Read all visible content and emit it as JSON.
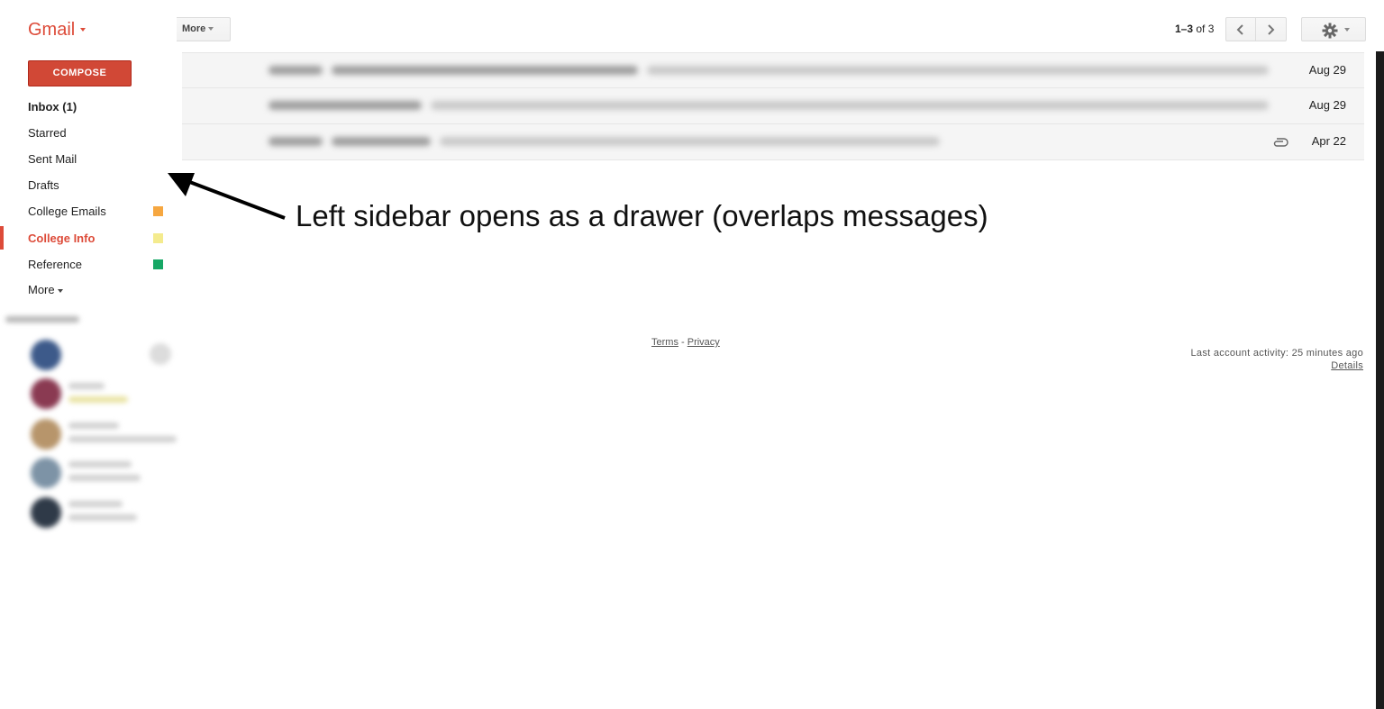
{
  "header": {
    "app_name": "Gmail",
    "more_label": "More",
    "pager_range": "1–3",
    "pager_of": "of 3"
  },
  "sidebar": {
    "compose_label": "COMPOSE",
    "items": [
      {
        "label": "Inbox (1)",
        "bold": true
      },
      {
        "label": "Starred"
      },
      {
        "label": "Sent Mail"
      },
      {
        "label": "Drafts"
      },
      {
        "label": "College Emails",
        "color": "#f6a740"
      },
      {
        "label": "College Info",
        "active": true,
        "color": "#f4eb8e"
      },
      {
        "label": "Reference",
        "color": "#16a765"
      }
    ],
    "more_label": "More"
  },
  "messages": [
    {
      "date": "Aug 29",
      "attachment": false
    },
    {
      "date": "Aug 29",
      "attachment": false
    },
    {
      "date": "Apr 22",
      "attachment": true
    }
  ],
  "annotation": "Left sidebar opens as a drawer (overlaps messages)",
  "footer": {
    "terms": "Terms",
    "separator": " - ",
    "privacy": "Privacy",
    "activity": "Last account activity: 25 minutes ago",
    "details": "Details"
  },
  "colors": {
    "accent": "#dd4b39",
    "compose_bg": "#d14836"
  }
}
